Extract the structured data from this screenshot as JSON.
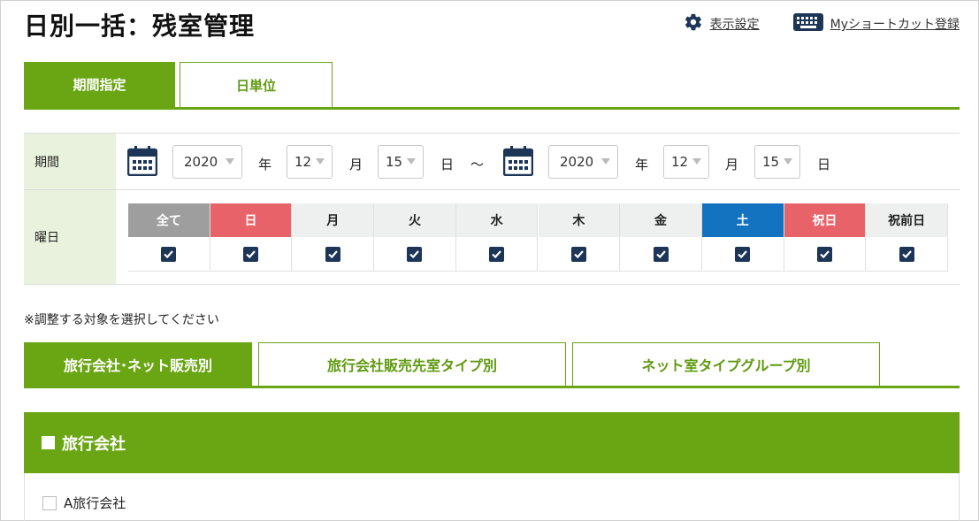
{
  "page": {
    "title": "日別一括：残室管理",
    "display_settings_label": "表示設定",
    "shortcut_label": "Myショートカット登録"
  },
  "period_tabs": [
    {
      "label": "期間指定",
      "active": true
    },
    {
      "label": "日単位",
      "active": false
    }
  ],
  "form": {
    "period_label": "期間",
    "weekday_label": "曜日",
    "start": {
      "year": "2020",
      "month": "12",
      "day": "15"
    },
    "end": {
      "year": "2020",
      "month": "12",
      "day": "15"
    },
    "unit_year": "年",
    "unit_month": "月",
    "unit_day": "日",
    "range_separator": "～"
  },
  "weekdays": [
    {
      "label": "全て",
      "checked": true,
      "bg": "#9e9e9e",
      "fg": "#ffffff"
    },
    {
      "label": "日",
      "checked": true,
      "bg": "#e8626a",
      "fg": "#ffffff"
    },
    {
      "label": "月",
      "checked": true,
      "bg": "#eef0f0",
      "fg": "#222222"
    },
    {
      "label": "火",
      "checked": true,
      "bg": "#eef0f0",
      "fg": "#222222"
    },
    {
      "label": "水",
      "checked": true,
      "bg": "#eef0f0",
      "fg": "#222222"
    },
    {
      "label": "木",
      "checked": true,
      "bg": "#eef0f0",
      "fg": "#222222"
    },
    {
      "label": "金",
      "checked": true,
      "bg": "#eef0f0",
      "fg": "#222222"
    },
    {
      "label": "土",
      "checked": true,
      "bg": "#1473c0",
      "fg": "#ffffff"
    },
    {
      "label": "祝日",
      "checked": true,
      "bg": "#e8626a",
      "fg": "#ffffff"
    },
    {
      "label": "祝前日",
      "checked": true,
      "bg": "#eef0f0",
      "fg": "#222222"
    }
  ],
  "note": "※調整する対象を選択してください",
  "target_tabs": [
    {
      "label": "旅行会社･ネット販売別",
      "active": true
    },
    {
      "label": "旅行会社販売先室タイプ別",
      "active": false
    },
    {
      "label": "ネット室タイプグループ別",
      "active": false
    }
  ],
  "section": {
    "title": "旅行会社",
    "items": [
      {
        "label": "A旅行会社",
        "checked": false
      }
    ]
  },
  "colors": {
    "brand_green": "#6aa514",
    "navy": "#1d3557"
  }
}
